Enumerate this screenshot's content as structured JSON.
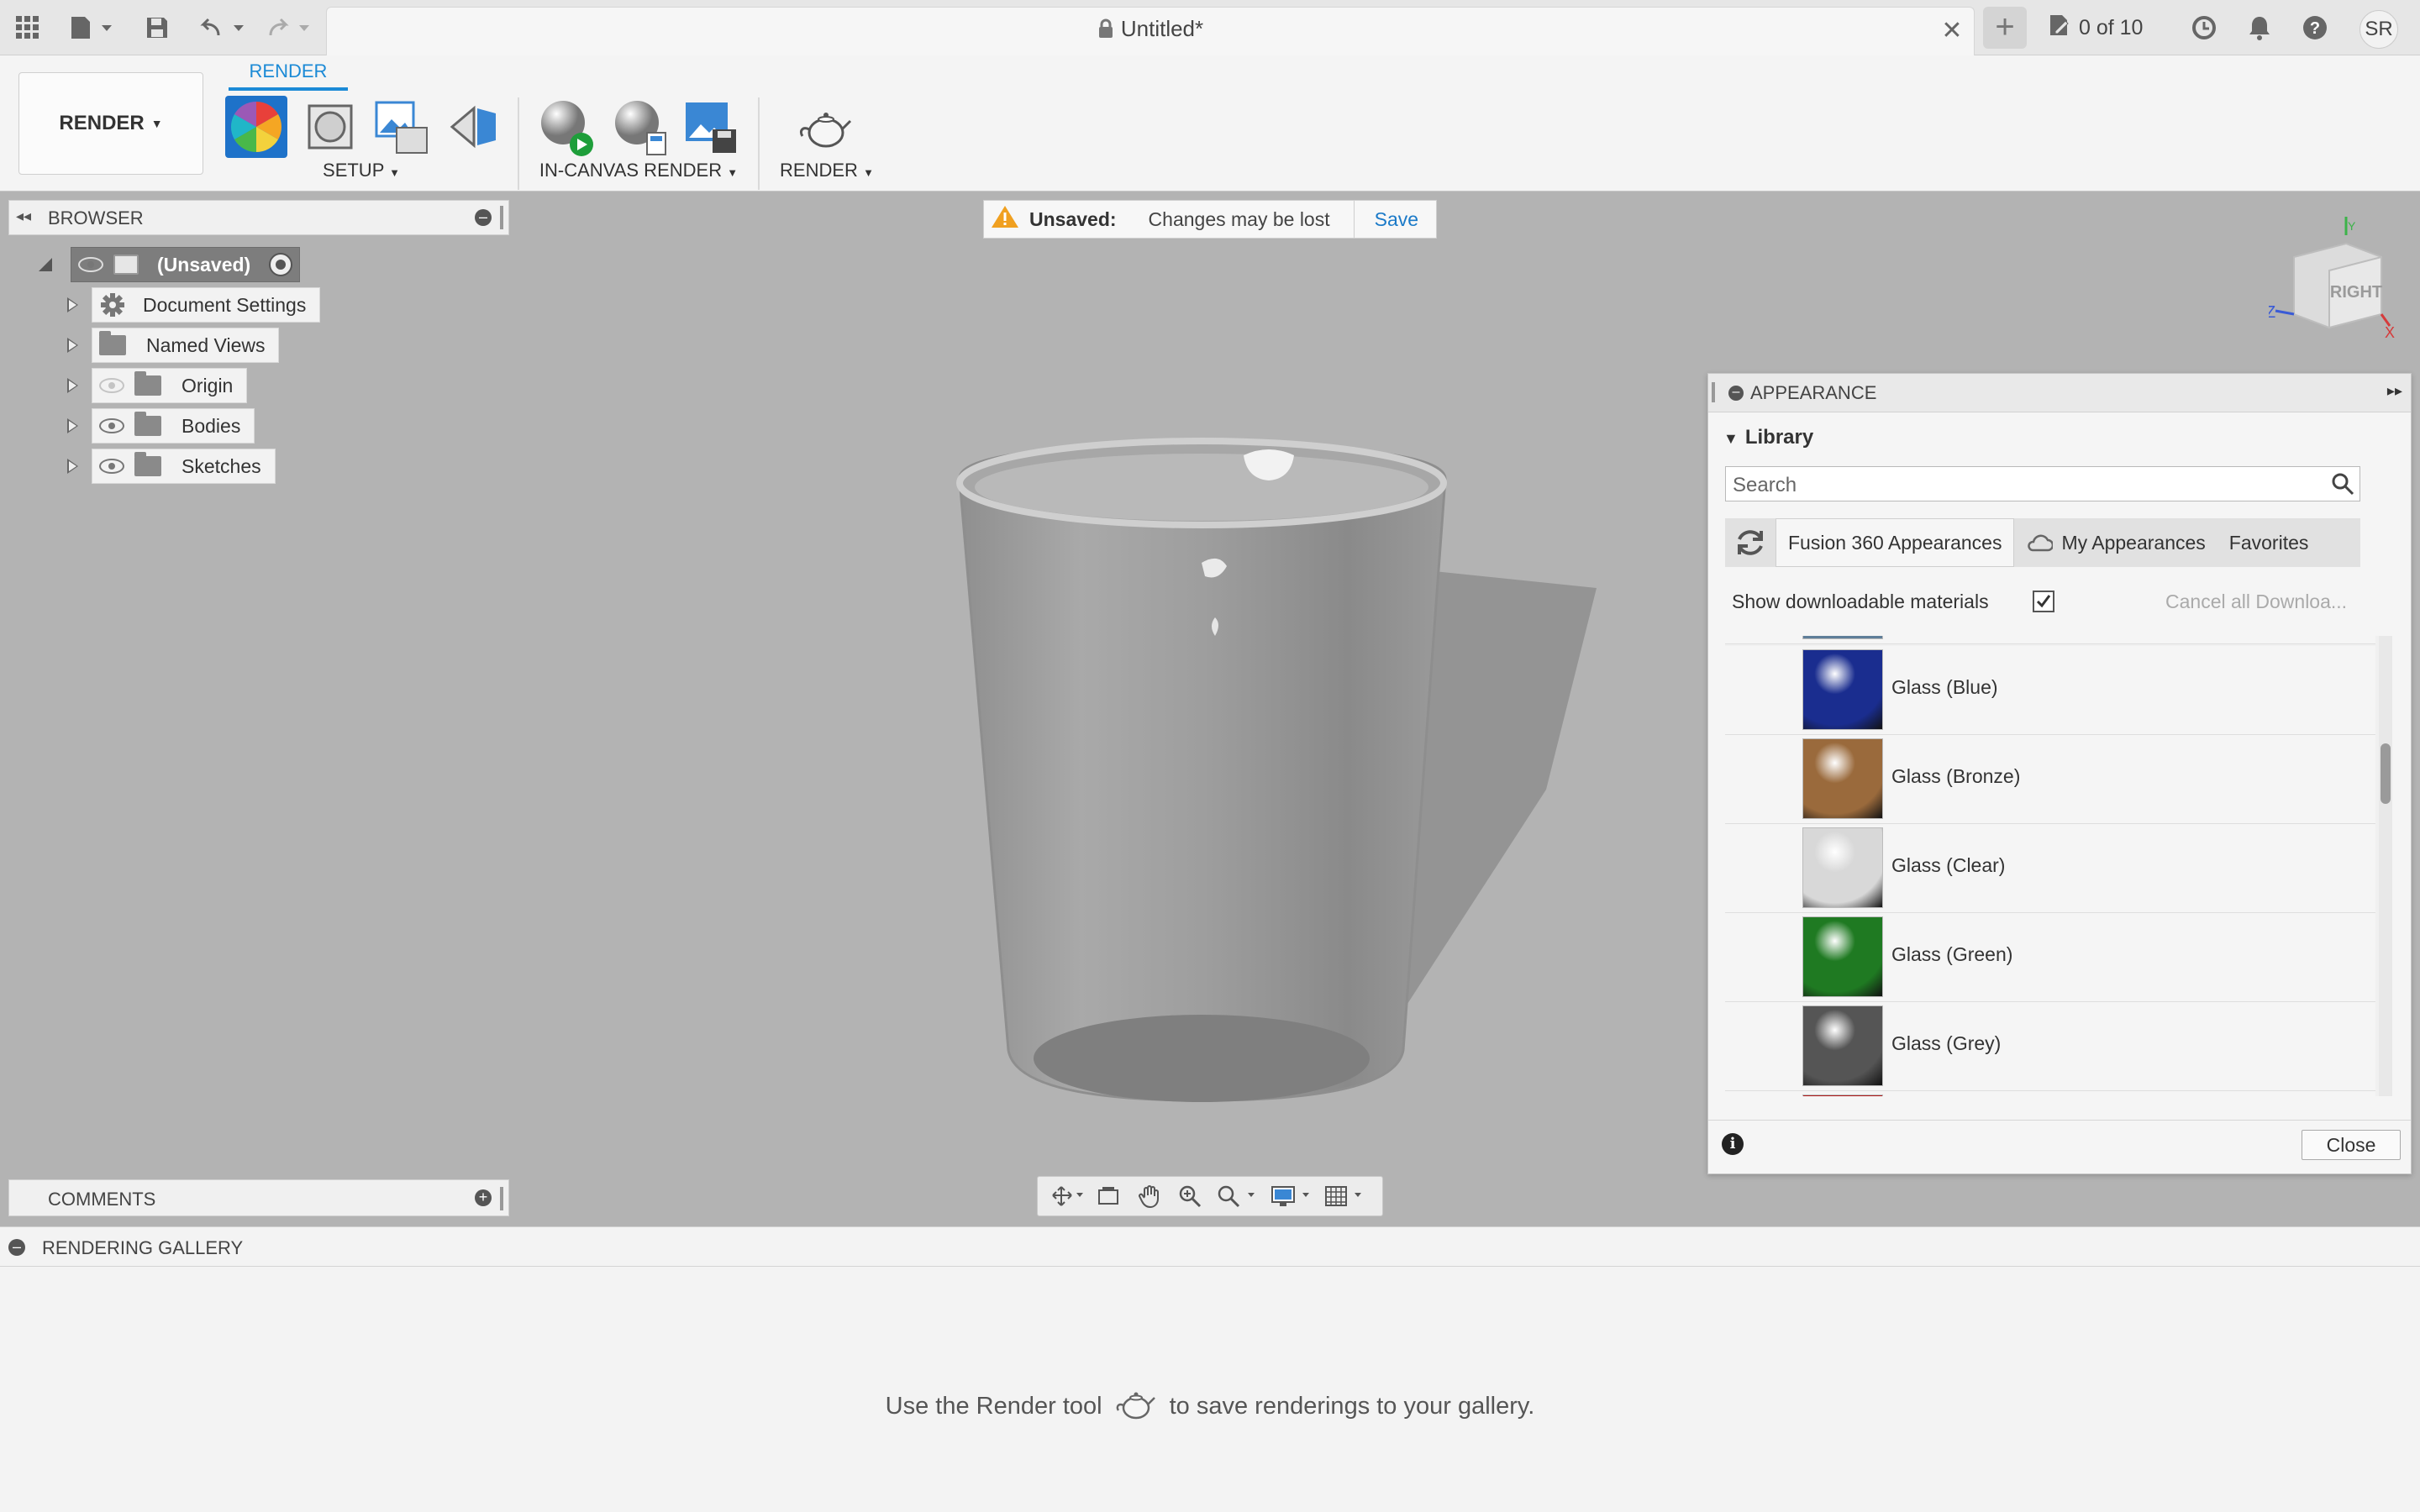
{
  "titlebar": {
    "document_title": "Untitled*",
    "job_status": "0 of 10",
    "user_initials": "SR"
  },
  "ribbon": {
    "workspace": "RENDER",
    "active_tab": "RENDER",
    "groups": {
      "setup": "SETUP",
      "in_canvas_render": "IN-CANVAS RENDER",
      "render": "RENDER"
    }
  },
  "browser": {
    "title": "BROWSER",
    "root": "(Unsaved)",
    "items": [
      {
        "label": "Document Settings",
        "icon": "gear-icon"
      },
      {
        "label": "Named Views",
        "icon": "folder-icon"
      },
      {
        "label": "Origin",
        "icon": "folder-icon",
        "visible": false
      },
      {
        "label": "Bodies",
        "icon": "folder-icon",
        "visible": true
      },
      {
        "label": "Sketches",
        "icon": "folder-icon",
        "visible": true
      }
    ]
  },
  "unsaved_banner": {
    "label": "Unsaved:",
    "message": "Changes may be lost",
    "action": "Save"
  },
  "viewcube": {
    "face": "RIGHT",
    "axis_z": "Z",
    "axis_x": "X",
    "axis_y": "Y"
  },
  "comments": {
    "title": "COMMENTS"
  },
  "appearance": {
    "title": "APPEARANCE",
    "section": "Library",
    "search_placeholder": "Search",
    "tabs": [
      "Fusion 360 Appearances",
      "My Appearances",
      "Favorites"
    ],
    "show_downloadable": "Show downloadable materials",
    "show_downloadable_checked": true,
    "cancel_downloads": "Cancel all Downloa...",
    "materials": [
      {
        "name": "Glass (Blue)",
        "color": "#1a2d8f"
      },
      {
        "name": "Glass (Bronze)",
        "color": "#9a6a3c"
      },
      {
        "name": "Glass (Clear)",
        "color": "#d8d8d8"
      },
      {
        "name": "Glass (Green)",
        "color": "#1f7a22"
      },
      {
        "name": "Glass (Grey)",
        "color": "#555555"
      }
    ],
    "close_label": "Close"
  },
  "gallery": {
    "title": "RENDERING GALLERY",
    "hint_before": "Use the Render tool",
    "hint_after": "to save renderings to your gallery."
  },
  "colors": {
    "accent": "#1b8ad6",
    "warning": "#f0a020"
  }
}
